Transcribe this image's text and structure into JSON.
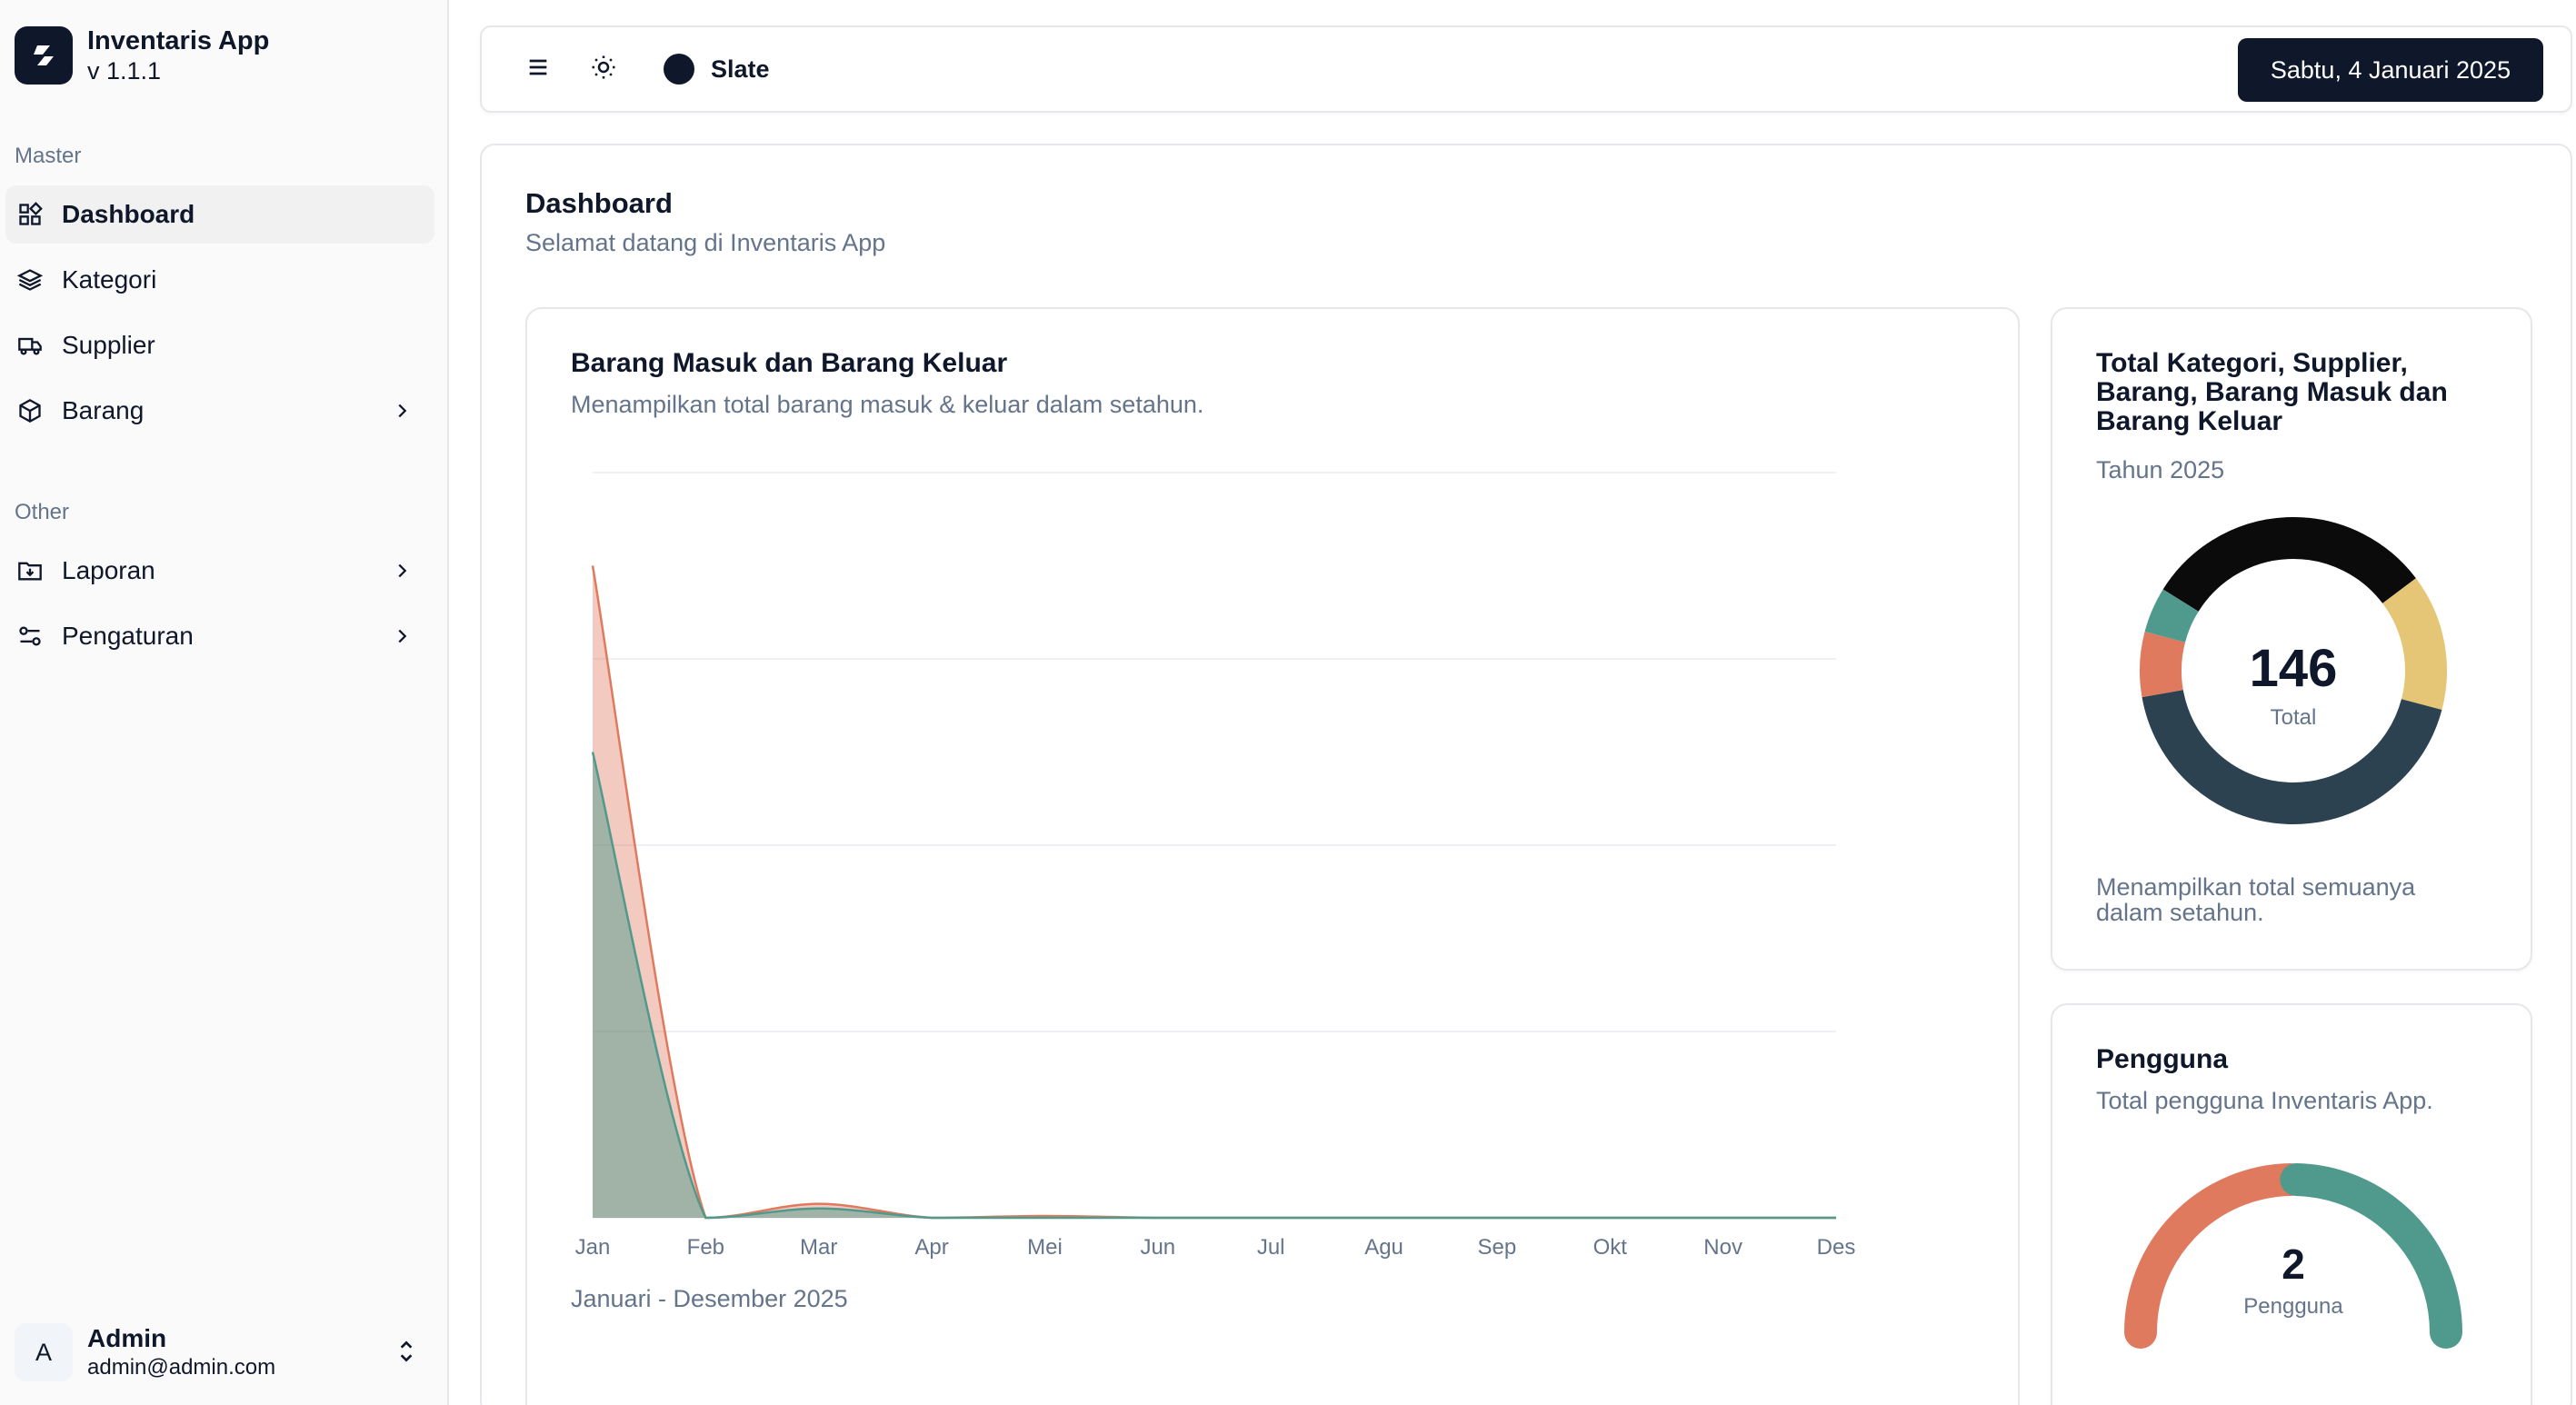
{
  "app": {
    "name": "Inventaris App",
    "version": "v 1.1.1"
  },
  "sidebar": {
    "groups": [
      {
        "label": "Master"
      },
      {
        "label": "Other"
      }
    ],
    "items": [
      {
        "label": "Dashboard",
        "icon": "dashboard-icon",
        "active": true
      },
      {
        "label": "Kategori",
        "icon": "layers-icon"
      },
      {
        "label": "Supplier",
        "icon": "truck-icon"
      },
      {
        "label": "Barang",
        "icon": "package-icon",
        "has_submenu": true
      },
      {
        "label": "Laporan",
        "icon": "folder-download-icon",
        "has_submenu": true
      },
      {
        "label": "Pengaturan",
        "icon": "settings-sliders-icon",
        "has_submenu": true
      }
    ],
    "user": {
      "avatar": "A",
      "name": "Admin",
      "email": "admin@admin.com"
    }
  },
  "topbar": {
    "theme": {
      "label": "Slate",
      "color": "#0f172a"
    },
    "date": "Sabtu, 4 Januari 2025"
  },
  "page": {
    "title": "Dashboard",
    "subtitle": "Selamat datang di Inventaris App"
  },
  "area_card": {
    "title": "Barang Masuk dan Barang Keluar",
    "subtitle": "Menampilkan total barang masuk & keluar dalam setahun.",
    "footer": "Januari - Desember 2025"
  },
  "donut_card": {
    "title": "Total Kategori, Supplier, Barang, Barang Masuk dan Barang Keluar",
    "subtitle": "Tahun 2025",
    "center_value": "146",
    "center_label": "Total",
    "footer": "Menampilkan total semuanya dalam setahun."
  },
  "gauge_card": {
    "title": "Pengguna",
    "subtitle": "Total pengguna Inventaris App.",
    "value": "2",
    "label": "Pengguna"
  },
  "colors": {
    "accent": "#0f172a",
    "series_masuk": "#e07a5f",
    "series_keluar": "#4f9a8d",
    "donut_black": "#0b0b0b",
    "donut_yellow": "#e5c676",
    "donut_navy": "#2d4251",
    "donut_orange": "#e07a5f",
    "donut_teal": "#4f9a8d"
  },
  "chart_data": [
    {
      "type": "area",
      "categories": [
        "Jan",
        "Feb",
        "Mar",
        "Apr",
        "Mei",
        "Jun",
        "Jul",
        "Agu",
        "Sep",
        "Okt",
        "Nov",
        "Des"
      ],
      "series": [
        {
          "values": [
            70,
            0,
            1.5,
            0,
            0.2,
            0,
            0,
            0,
            0,
            0,
            0,
            0
          ]
        },
        {
          "values": [
            50,
            0,
            1,
            0,
            0,
            0,
            0,
            0,
            0,
            0,
            0,
            0
          ]
        }
      ],
      "ylim": [
        0,
        80
      ],
      "grid": true,
      "legend": "none"
    },
    {
      "type": "pie",
      "variant": "donut",
      "values": [
        45,
        21,
        63,
        10,
        7
      ],
      "total": 146
    },
    {
      "type": "pie",
      "variant": "half-donut-gauge",
      "values": [
        1,
        1
      ],
      "total": 2
    }
  ]
}
